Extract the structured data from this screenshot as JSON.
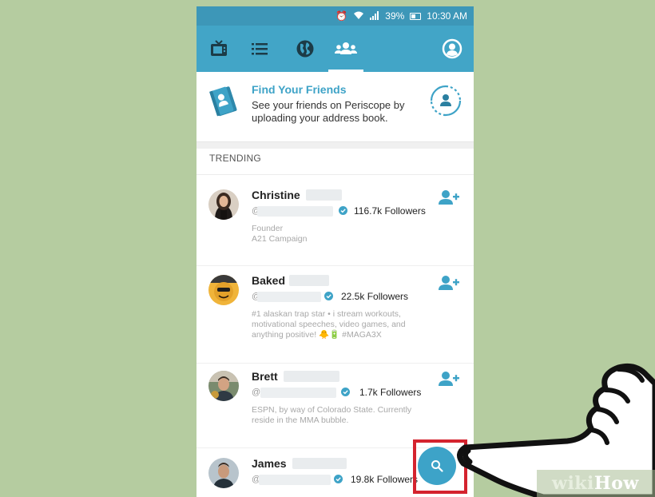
{
  "status_bar": {
    "battery_percent": "39%",
    "time": "10:30 AM"
  },
  "nav": {
    "tabs": [
      {
        "id": "tv",
        "icon": "tv-icon"
      },
      {
        "id": "list",
        "icon": "list-icon"
      },
      {
        "id": "globe",
        "icon": "globe-icon"
      },
      {
        "id": "people",
        "icon": "people-icon",
        "active": true
      }
    ],
    "profile_icon": "profile-icon"
  },
  "find_friends": {
    "title": "Find Your Friends",
    "description": "See your friends on Periscope by uploading your address book."
  },
  "trending": {
    "header": "TRENDING",
    "users": [
      {
        "name": "Christine",
        "handle_prefix": "@",
        "followers": "116.7k Followers",
        "bio_line1": "Founder",
        "bio_line2": "A21 Campaign"
      },
      {
        "name": "Baked",
        "handle_prefix": "@",
        "followers": "22.5k Followers",
        "bio_line1": "#1 alaskan trap star • i stream workouts,",
        "bio_line2": "motivational speeches, video games, and",
        "bio_line3": "anything positive! 🐥🔋 #MAGA3X"
      },
      {
        "name": "Brett",
        "handle_prefix": "@",
        "followers": "1.7k Followers",
        "bio_line1": "ESPN, by way of Colorado State. Currently",
        "bio_line2": "reside in the MMA bubble."
      },
      {
        "name": "James",
        "handle_prefix": "@",
        "followers": "19.8k Followers"
      }
    ]
  },
  "watermark": {
    "wiki": "wiki",
    "how": "How"
  },
  "colors": {
    "background": "#b5cca0",
    "status_bar": "#3d97b8",
    "nav_bar": "#42a5c7",
    "accent": "#3ea3c7",
    "highlight": "#d4232e"
  }
}
